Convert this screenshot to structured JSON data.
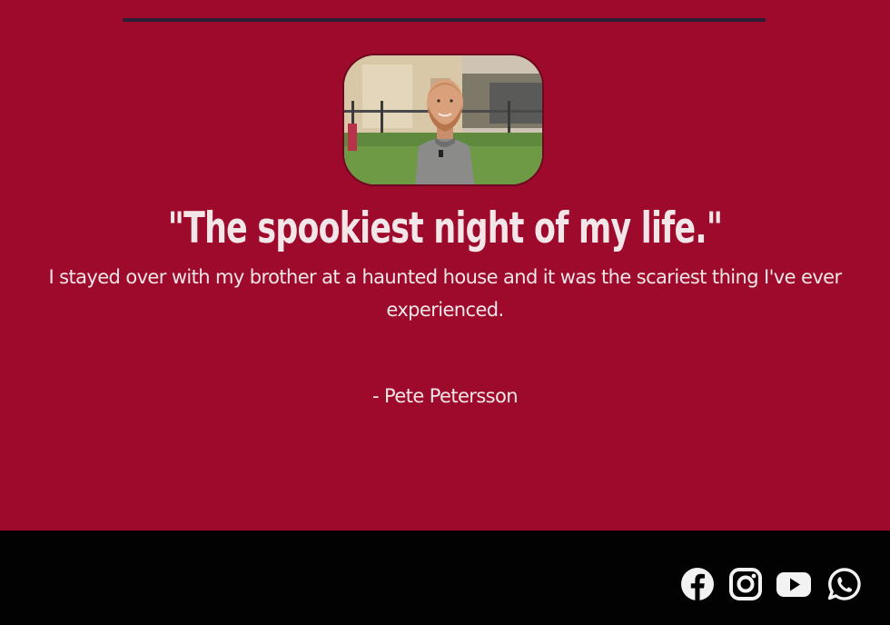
{
  "testimonial": {
    "quote": "\"The spookiest night of my life.\"",
    "story": "I stayed over with my brother at a haunted house and it was the scariest thing I've ever experienced.",
    "author": "- Pete Petersson"
  },
  "colors": {
    "section_background": "#9e0a2b",
    "footer_background": "#020203",
    "text": "#f2e6e8",
    "divider": "#2b1d33"
  },
  "footer": {
    "social_icons": [
      "facebook-icon",
      "instagram-icon",
      "youtube-icon",
      "whatsapp-icon"
    ]
  }
}
